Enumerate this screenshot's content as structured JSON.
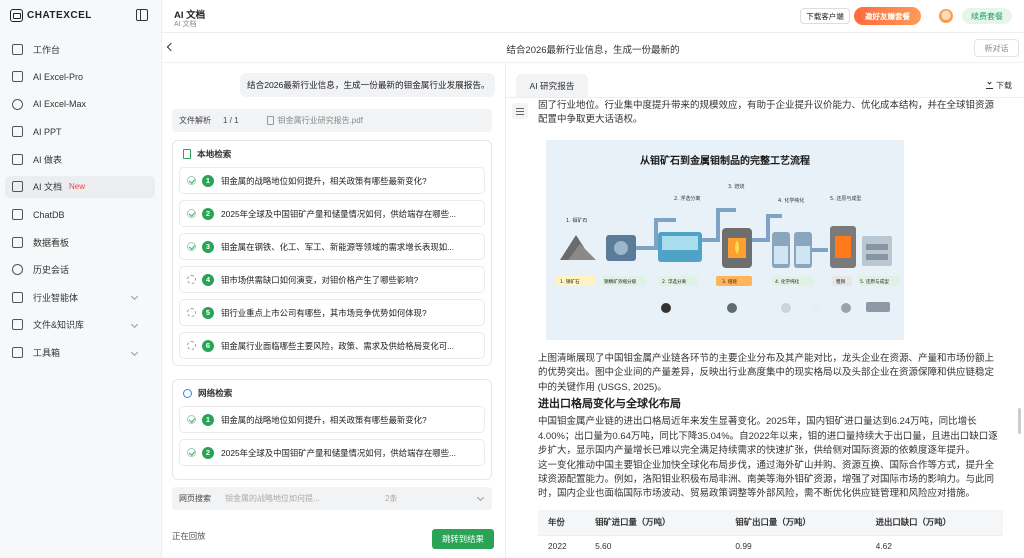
{
  "brand": {
    "name": "CHATEXCEL"
  },
  "sidebar": {
    "items": [
      {
        "label": "工作台",
        "icon": "grid-icon"
      },
      {
        "label": "AI Excel-Pro",
        "icon": "excel-icon"
      },
      {
        "label": "AI Excel-Max",
        "icon": "excel-max-icon"
      },
      {
        "label": "AI PPT",
        "icon": "ppt-icon"
      },
      {
        "label": "AI 做表",
        "icon": "table-icon"
      },
      {
        "label": "AI 文档",
        "icon": "document-icon",
        "badge": "New",
        "active": true
      },
      {
        "label": "ChatDB",
        "icon": "database-icon"
      },
      {
        "label": "数据看板",
        "icon": "dashboard-icon"
      },
      {
        "label": "历史会话",
        "icon": "history-icon"
      },
      {
        "label": "行业智能体",
        "icon": "agent-icon",
        "expandable": true
      },
      {
        "label": "文件&知识库",
        "icon": "folder-icon",
        "expandable": true
      },
      {
        "label": "工具箱",
        "icon": "toolbox-icon",
        "expandable": true
      }
    ]
  },
  "topbar": {
    "title": "AI 文档",
    "subtitle": "AI 文档",
    "download_client": "下载客户端",
    "invite": "邀好友赚套餐",
    "renew": "续费套餐"
  },
  "header": {
    "conversation_title": "结合2026最新行业信息，生成一份最新的",
    "new_chat": "新对话"
  },
  "chat": {
    "user_message": "结合2026最新行业信息，生成一份最新的钼金属行业发展报告。",
    "file_bar": {
      "label": "文件解析",
      "count": "1 / 1",
      "file_name": "钼金属行业研究报告.pdf"
    },
    "local_search": {
      "title": "本地检索",
      "rows": [
        {
          "num": "1",
          "text": "钼金属的战略地位如何提升，相关政策有哪些最新变化?",
          "status": "done"
        },
        {
          "num": "2",
          "text": "2025年全球及中国钼矿产量和储量情况如何，供给端存在哪些...",
          "status": "done"
        },
        {
          "num": "3",
          "text": "钼金属在钢铁、化工、军工、新能源等领域的需求增长表现如...",
          "status": "done"
        },
        {
          "num": "4",
          "text": "钼市场供需缺口如何演变，对钼价格产生了哪些影响?",
          "status": "pending"
        },
        {
          "num": "5",
          "text": "钼行业重点上市公司有哪些，其市场竞争优势如何体现?",
          "status": "pending"
        },
        {
          "num": "6",
          "text": "钼金属行业面临哪些主要风险，政策、需求及供给格局变化可...",
          "status": "pending"
        }
      ]
    },
    "web_search": {
      "title": "网络检索",
      "rows": [
        {
          "num": "1",
          "text": "钼金属的战略地位如何提升，相关政策有哪些最新变化?",
          "status": "done"
        },
        {
          "num": "2",
          "text": "2025年全球及中国钼矿产量和储量情况如何，供给端存在哪些...",
          "status": "done"
        }
      ]
    },
    "web_search_bar": {
      "label": "网页搜索",
      "query": "钼金属的战略地位如何提...",
      "count": "2条"
    },
    "status_text": "正在回放",
    "jump_button": "跳转到结果"
  },
  "report": {
    "tab": "AI 研究报告",
    "download": "下载",
    "intro_para": "固了行业地位。行业集中度提升带来的规模效应，有助于企业提升议价能力、优化成本结构，并在全球钼资源配置中争取更大话语权。",
    "figure": {
      "title": "从钼矿石到金属钼制品的完整工艺流程",
      "steps": [
        "1. 钼矿石",
        "2. 浮选分离",
        "3. 焙烧",
        "4. 化学纯化",
        "5. 还原与成型"
      ],
      "bottom_labels": [
        "1. 钼矿石",
        "钼精矿浓缩分级",
        "2. 浮选分离",
        "3. 焙烧",
        "4. 化学纯化",
        "粗钼",
        "5. 还原与成型"
      ]
    },
    "para_after_figure": "上图清晰展现了中国钼金属产业链各环节的主要企业分布及其产能对比，龙头企业在资源、产量和市场份额上的优势突出。图中企业间的产量差异，反映出行业高度集中的现实格局以及头部企业在资源保障和供应链稳定中的关键作用 (USGS, 2025)。",
    "section_title": "进出口格局变化与全球化布局",
    "section_para1": "中国钼金属产业链的进出口格局近年来发生显著变化。2025年，国内钼矿进口量达到6.24万吨，同比增长4.00%；出口量为0.64万吨，同比下降35.04%。自2022年以来，钼的进口量持续大于出口量，且进出口缺口逐步扩大，显示国内产量增长已难以完全满足持续需求的快速扩张，供给侧对国际资源的依赖度逐年提升。",
    "section_para2": "这一变化推动中国主要钼企业加快全球化布局步伐，通过海外矿山并购、资源互换、国际合作等方式，提升全球资源配置能力。例如，洛阳钼业积极布局非洲、南美等海外钼矿资源，增强了对国际市场的影响力。与此同时，国内企业也面临国际市场波动、贸易政策调整等外部风险，需不断优化供应链管理和风险应对措施。",
    "table": {
      "headers": [
        "年份",
        "钼矿进口量（万吨）",
        "钼矿出口量（万吨）",
        "进出口缺口（万吨）"
      ],
      "rows": [
        [
          "2022",
          "5.60",
          "0.99",
          "4.62"
        ]
      ]
    }
  }
}
